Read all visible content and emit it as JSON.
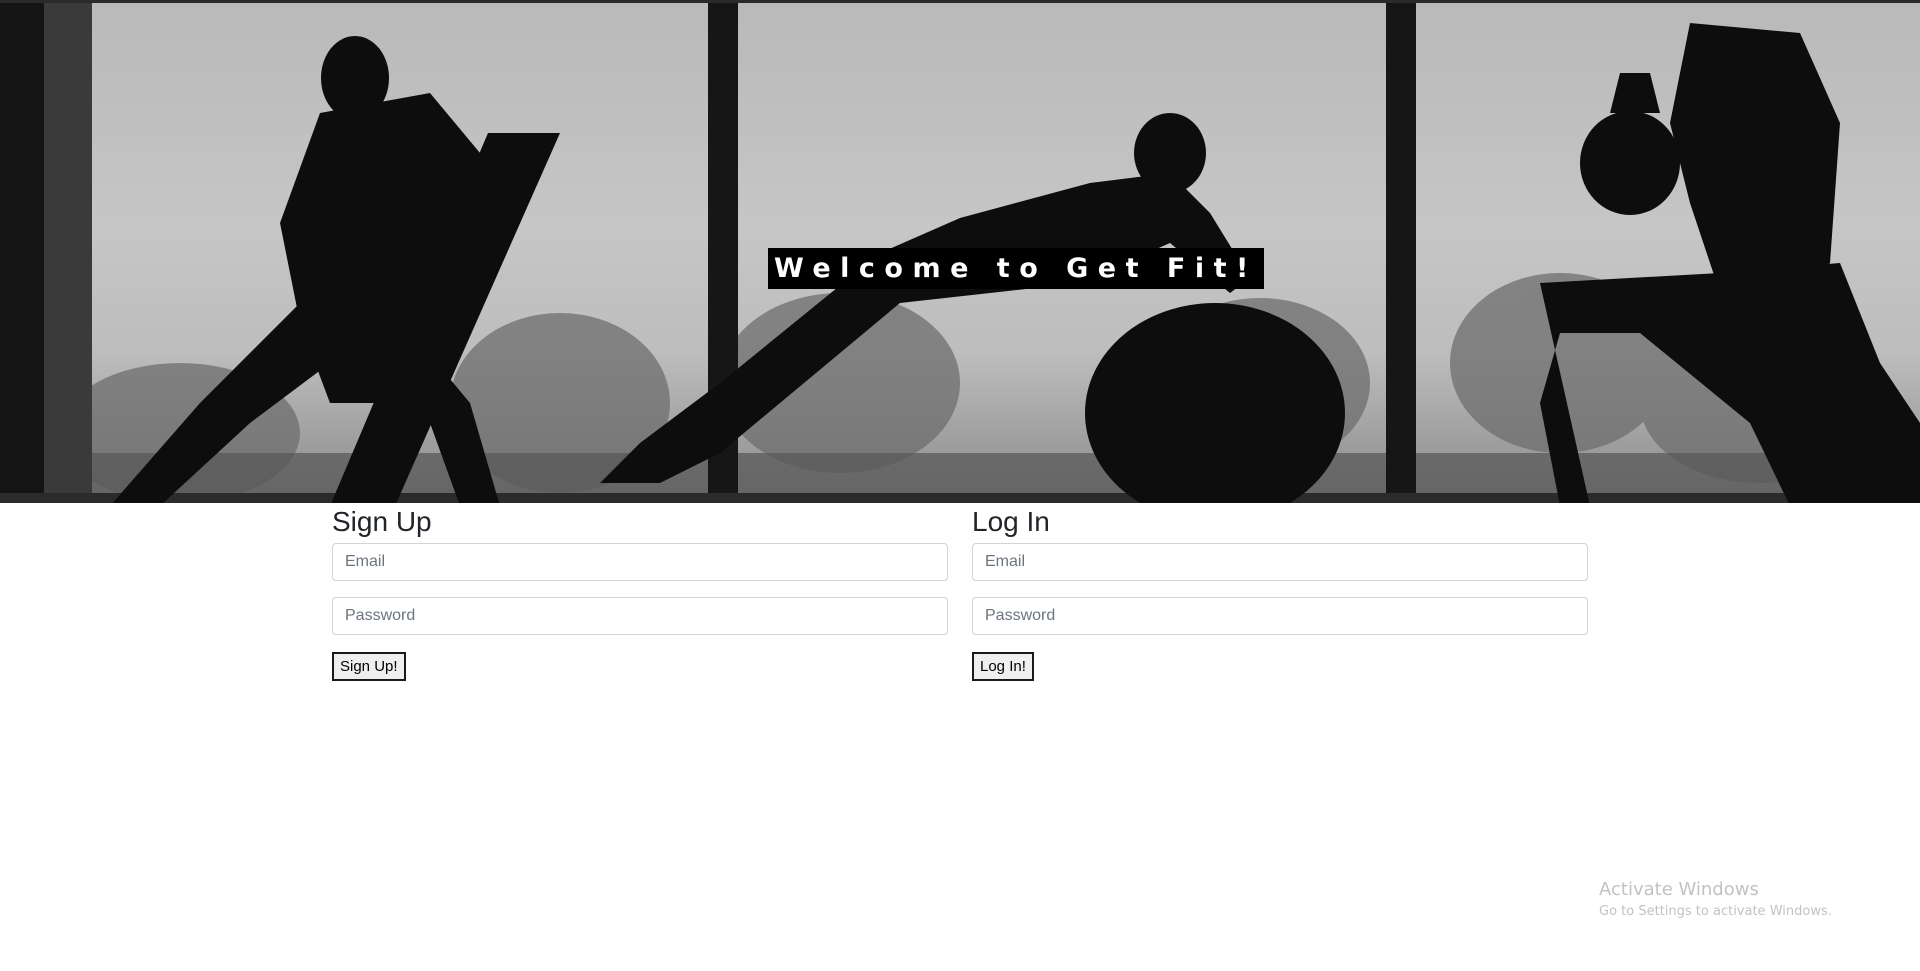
{
  "hero": {
    "image_name": "gym-silhouette-banner",
    "title": "Welcome to Get Fit!"
  },
  "signup": {
    "heading": "Sign Up",
    "email_placeholder": "Email",
    "email_value": "",
    "password_placeholder": "Password",
    "password_value": "",
    "button_label": "Sign Up!"
  },
  "login": {
    "heading": "Log In",
    "email_placeholder": "Email",
    "email_value": "",
    "password_placeholder": "Password",
    "password_value": "",
    "button_label": "Log In!"
  },
  "watermark": {
    "title": "Activate Windows",
    "subtitle": "Go to Settings to activate Windows."
  },
  "colors": {
    "hero_title_bg": "#000000",
    "hero_title_text": "#ffffff",
    "input_border": "#ced4da",
    "button_bg": "#efefef"
  }
}
